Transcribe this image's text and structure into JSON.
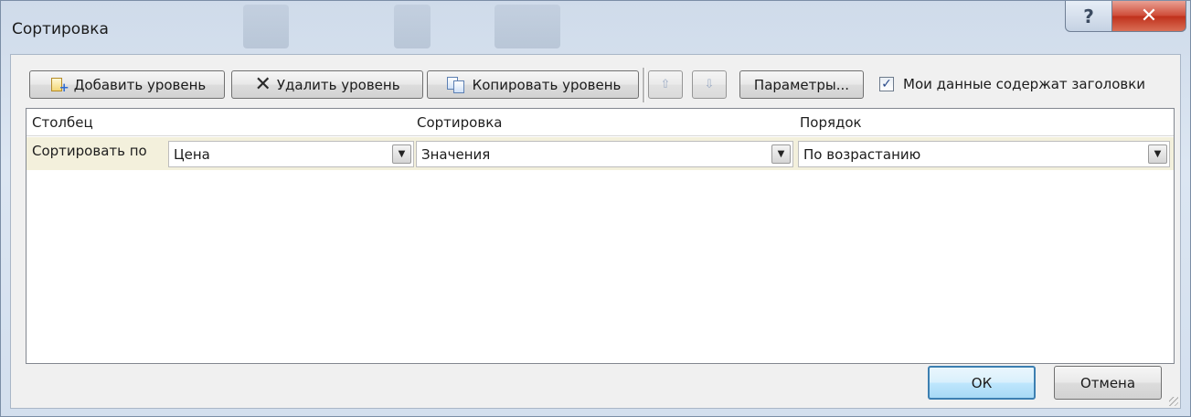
{
  "window": {
    "title": "Сортировка",
    "help_glyph": "?",
    "close_glyph": "✕"
  },
  "toolbar": {
    "add_level_label": "Добавить уровень",
    "delete_level_label": "Удалить уровень",
    "copy_level_label": "Копировать уровень",
    "move_up_glyph": "⇧",
    "move_down_glyph": "⇩",
    "options_label": "Параметры...",
    "headers_checkbox": {
      "label": "Мои данные содержат заголовки",
      "checked": true,
      "check_glyph": "✓"
    }
  },
  "grid": {
    "headers": {
      "column": "Столбец",
      "sort_on": "Сортировка",
      "order": "Порядок"
    },
    "rows": [
      {
        "label": "Сортировать по",
        "column_value": "Цена",
        "sort_on_value": "Значения",
        "order_value": "По возрастанию"
      }
    ],
    "drop_glyph": "▼"
  },
  "footer": {
    "ok_label": "ОК",
    "cancel_label": "Отмена"
  },
  "colors": {
    "frame": "#d3dfee",
    "close_button": "#c0311c",
    "selected_row": "#f3f0dc",
    "ok_border": "#3c7fb1"
  }
}
